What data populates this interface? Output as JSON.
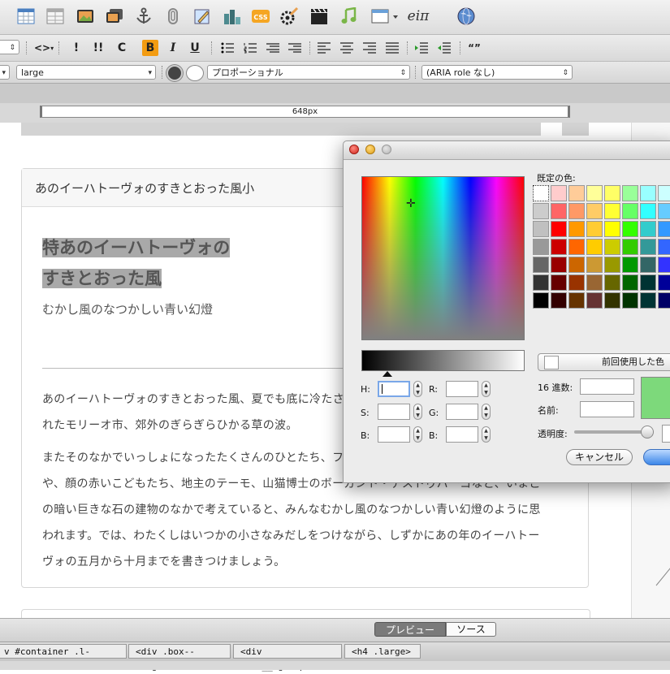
{
  "toolbar": {
    "icons": [
      "table-icon",
      "table-grid-icon",
      "image-icon",
      "image-multi-icon",
      "anchor-icon",
      "paperclip-icon",
      "edit-image-icon",
      "chart-icon",
      "css-icon",
      "widget-icon",
      "video-icon",
      "audio-icon",
      "window-icon",
      "math-icon",
      "globe-icon"
    ],
    "css_label": "CSS",
    "math_label": "eiπ"
  },
  "format": {
    "code_label": "<>",
    "exclaim": "!",
    "double_exclaim": "!!",
    "c_label": "C",
    "bold": "B",
    "italic": "I",
    "underline": "U",
    "quote_label": "“”",
    "bold_active_color": "#f39c12"
  },
  "props": {
    "size_value": "large",
    "font_value": "プロポーショナル",
    "aria_value": "(ARIA role なし)"
  },
  "ruler": {
    "width_label": "648px"
  },
  "doc": {
    "box_title": "あのイーハトーヴォのすきとおった風小",
    "heading_line1": "特あのイーハトーヴォの",
    "heading_line2": "すきとおった風",
    "subtitle": "むかし風のなつかしい青い幻燈",
    "para1_line1": "あのイーハトーヴォのすきとおった風、夏でも底に冷たさをもつ青いそら、うつくしい森で飾ら",
    "para1_line2": "れたモリーオ市、郊外のぎらぎらひかる草の波。",
    "para2_line1": "またそのなかでいっしょになったたくさんのひとたち、ファゼーロとロザーロ、羊飼のミーロ",
    "para2_line2": "や、顔の赤いこどもたち、地主のテーモ、山猫博士のボーガント・デストゥパーゴなど、いまこ",
    "para2_line3": "の暗い巨きな石の建物のなかで考えていると、みんなむかし風のなつかしい青い幻燈のように思",
    "para2_line4": "われます。では、わたくしはいつかの小さなみだしをつけながら、しずかにあの年のイーハトー",
    "para2_line5": "ヴォの五月から十月までを書きつけましょう。"
  },
  "tabs": {
    "preview": "プレビュー",
    "source": "ソース"
  },
  "breadcrumbs": [
    "v #container .l-container>",
    "<div .box--large>",
    "<div .box__hgroup>",
    "<h4 .large>"
  ],
  "color_panel": {
    "swatches_label": "既定の色:",
    "h_label": "H:",
    "s_label": "S:",
    "b_label": "B:",
    "r_label": "R:",
    "g_label": "G:",
    "b2_label": "B:",
    "recent_label": "前回使用した色",
    "hex_label": "16 進数:",
    "name_label": "名前:",
    "opacity_label": "透明度:",
    "cancel": "キャンセル",
    "selected_color": "#7dd97b",
    "swatch_rows": [
      [
        "#ffffff",
        "#ffcccc",
        "#ffcc99",
        "#ffff99",
        "#ffff66",
        "#99ff99",
        "#99ffff",
        "#ccffff"
      ],
      [
        "#cccccc",
        "#ff6666",
        "#ff9966",
        "#ffcc66",
        "#ffff33",
        "#66ff66",
        "#33ffff",
        "#66ccff"
      ],
      [
        "#c0c0c0",
        "#ff0000",
        "#ff9900",
        "#ffcc33",
        "#ffff00",
        "#33ff00",
        "#33cccc",
        "#3399ff"
      ],
      [
        "#999999",
        "#cc0000",
        "#ff6600",
        "#ffcc00",
        "#cccc00",
        "#33cc00",
        "#339999",
        "#3366ff"
      ],
      [
        "#666666",
        "#990000",
        "#cc6600",
        "#cc9933",
        "#999900",
        "#009900",
        "#336666",
        "#3333ff"
      ],
      [
        "#333333",
        "#660000",
        "#993300",
        "#996633",
        "#666600",
        "#006600",
        "#003333",
        "#000099"
      ],
      [
        "#000000",
        "#330000",
        "#663300",
        "#663333",
        "#333300",
        "#003300",
        "#003333",
        "#000066"
      ]
    ]
  }
}
